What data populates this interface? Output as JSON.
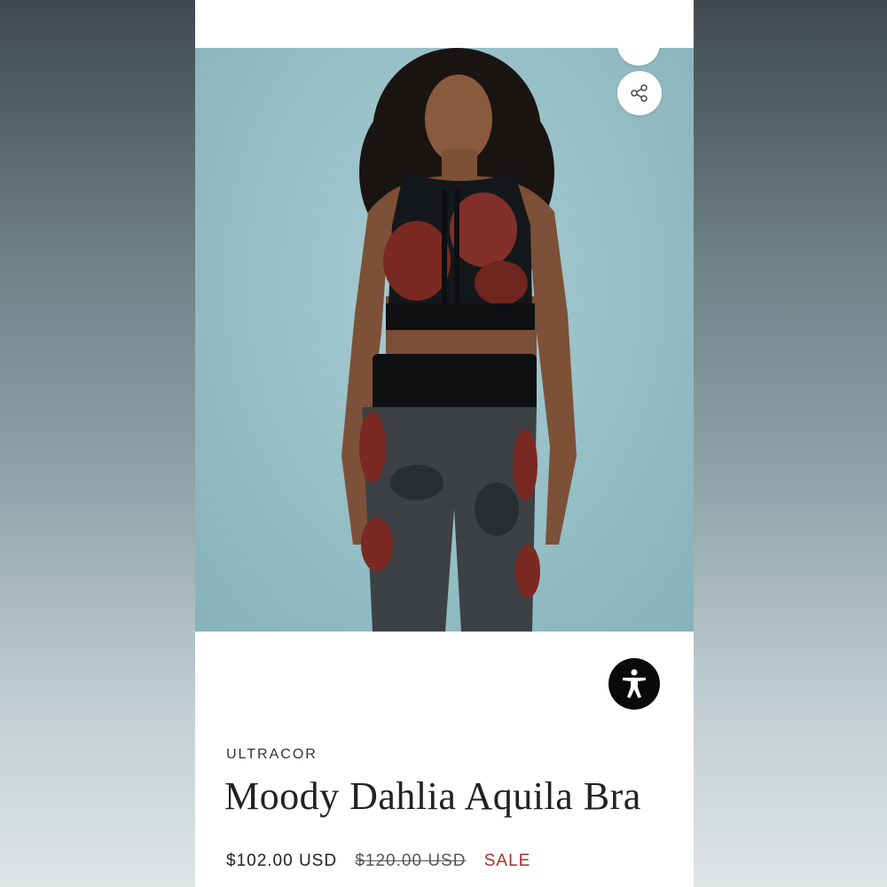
{
  "product": {
    "brand": "ULTRACOR",
    "title": "Moody Dahlia Aquila Bra",
    "price": "$102.00 USD",
    "original_price": "$120.00 USD",
    "sale_label": "SALE"
  },
  "icons": {
    "share": "share-icon",
    "accessibility": "accessibility-icon"
  },
  "colors": {
    "sale": "#a3322b",
    "hero_bg": "#9cc4ca",
    "accessibility_bg": "#0a0a0a"
  }
}
